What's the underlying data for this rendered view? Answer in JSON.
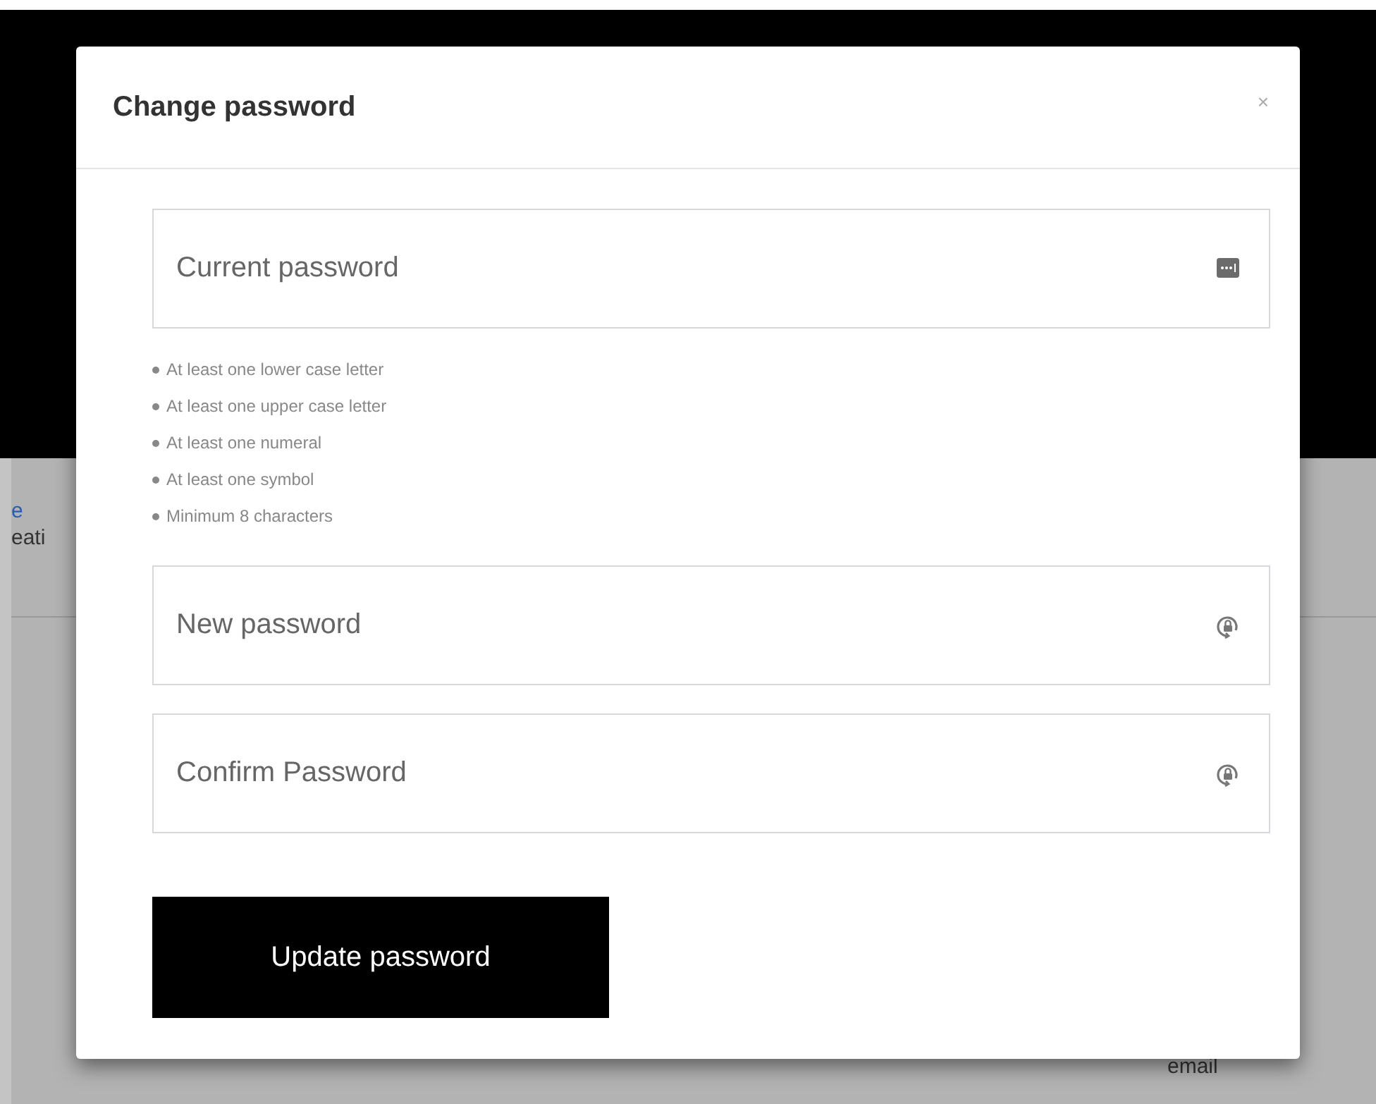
{
  "background": {
    "link_fragment": "e",
    "text_fragment": "eati",
    "label": "email"
  },
  "dialog": {
    "title": "Change password",
    "close": "×",
    "fields": [
      {
        "placeholder": "Current password",
        "kind": "autofill"
      },
      {
        "placeholder": "New password",
        "kind": "generate"
      },
      {
        "placeholder": "Confirm Password",
        "kind": "generate"
      }
    ],
    "hints": [
      "At least one lower case letter",
      "At least one upper case letter",
      "At least one numeral",
      "At least one symbol",
      "Minimum 8 characters"
    ],
    "submit": "Update password"
  }
}
